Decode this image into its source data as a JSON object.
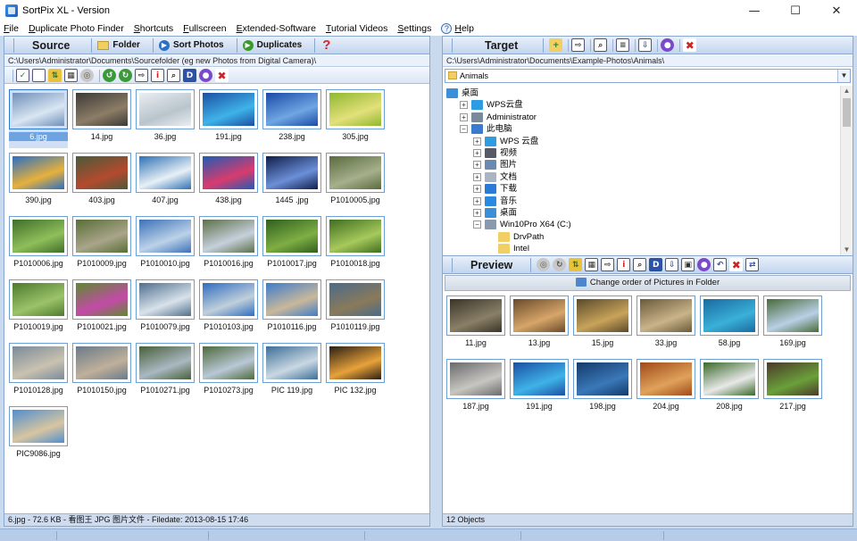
{
  "window": {
    "title": "SortPix XL - Version"
  },
  "menu": [
    {
      "label": "File",
      "ul": "F",
      "rest": "ile"
    },
    {
      "label": "Duplicate Photo Finder",
      "ul": "D",
      "rest": "uplicate Photo Finder"
    },
    {
      "label": "Shortcuts",
      "ul": "S",
      "rest": "hortcuts"
    },
    {
      "label": "Fullscreen",
      "ul": "F",
      "rest": "ullscreen"
    },
    {
      "label": "Extended-Software",
      "ul": "E",
      "rest": "xtended-Software"
    },
    {
      "label": "Tutorial Videos",
      "ul": "T",
      "rest": "utorial Videos"
    },
    {
      "label": "Settings",
      "ul": "S",
      "rest": "ettings"
    },
    {
      "label": "Help",
      "ul": "H",
      "rest": "elp"
    }
  ],
  "source": {
    "title": "Source",
    "buttons": {
      "folder": "Folder",
      "sort": "Sort Photos",
      "duplicates": "Duplicates"
    },
    "path": "C:\\Users\\Administrator\\Documents\\Sourcefolder (eg new Photos from Digital Camera)\\",
    "status": "6.jpg - 72.6 KB - 看图王 JPG 图片文件 - Filedate: 2013-08-15 17:46",
    "thumbs": [
      {
        "name": "6.jpg",
        "c1": "#6f8fb8",
        "c2": "#d9e6f3",
        "selected": true
      },
      {
        "name": "14.jpg",
        "c1": "#3c3a36",
        "c2": "#8c7d66"
      },
      {
        "name": "36.jpg",
        "c1": "#e9eef2",
        "c2": "#b9c4cc"
      },
      {
        "name": "191.jpg",
        "c1": "#1b4fa3",
        "c2": "#3fb3e8"
      },
      {
        "name": "238.jpg",
        "c1": "#1a4aa8",
        "c2": "#6fa6e2"
      },
      {
        "name": "305.jpg",
        "c1": "#8fb830",
        "c2": "#e3e07a"
      },
      {
        "name": "390.jpg",
        "c1": "#2a6ec4",
        "c2": "#e7b13b"
      },
      {
        "name": "403.jpg",
        "c1": "#4a5a3a",
        "c2": "#b44a2e"
      },
      {
        "name": "407.jpg",
        "c1": "#2f71b5",
        "c2": "#e8f0f6"
      },
      {
        "name": "438.jpg",
        "c1": "#1f5cb4",
        "c2": "#d93b6e"
      },
      {
        "name": "1445 .jpg",
        "c1": "#0f1e4a",
        "c2": "#6c8fd8"
      },
      {
        "name": "P1010005.jpg",
        "c1": "#5a6a3e",
        "c2": "#a6b08c"
      },
      {
        "name": "P1010006.jpg",
        "c1": "#3f6e2a",
        "c2": "#8fbf5a"
      },
      {
        "name": "P1010009.jpg",
        "c1": "#596d36",
        "c2": "#a9a58a"
      },
      {
        "name": "P1010010.jpg",
        "c1": "#3b71b8",
        "c2": "#bcd2e8"
      },
      {
        "name": "P1010016.jpg",
        "c1": "#5c7048",
        "c2": "#c6d0dc"
      },
      {
        "name": "P1010017.jpg",
        "c1": "#2f5f1e",
        "c2": "#7fae44"
      },
      {
        "name": "P1010018.jpg",
        "c1": "#3e6e20",
        "c2": "#a7c95c"
      },
      {
        "name": "P1010019.jpg",
        "c1": "#4d7a2d",
        "c2": "#9bc36a"
      },
      {
        "name": "P1010021.jpg",
        "c1": "#5d8a2f",
        "c2": "#c44aa8"
      },
      {
        "name": "P1010079.jpg",
        "c1": "#4f6f8f",
        "c2": "#d8e2ea"
      },
      {
        "name": "P1010103.jpg",
        "c1": "#2f6cc0",
        "c2": "#c0cfda"
      },
      {
        "name": "P1010116.jpg",
        "c1": "#3e7ccb",
        "c2": "#c9b89a"
      },
      {
        "name": "P1010119.jpg",
        "c1": "#4a6a8a",
        "c2": "#8a7a5a"
      },
      {
        "name": "P1010128.jpg",
        "c1": "#7a8a9a",
        "c2": "#c9c2b0"
      },
      {
        "name": "P1010150.jpg",
        "c1": "#6a7a8a",
        "c2": "#bfb09a"
      },
      {
        "name": "P1010271.jpg",
        "c1": "#48603a",
        "c2": "#aab8c2"
      },
      {
        "name": "P1010273.jpg",
        "c1": "#4e6a3c",
        "c2": "#b9c8d6"
      },
      {
        "name": "PIC 119.jpg",
        "c1": "#3d6e98",
        "c2": "#c9d8e2"
      },
      {
        "name": "PIC 132.jpg",
        "c1": "#2a1e14",
        "c2": "#e8a23a"
      },
      {
        "name": "PIC9086.jpg",
        "c1": "#4f8fcf",
        "c2": "#d8c5a0"
      }
    ]
  },
  "target": {
    "title": "Target",
    "path": "C:\\Users\\Administrator\\Documents\\Example-Photos\\Animals\\",
    "combo": "Animals",
    "tree": [
      {
        "label": "桌面",
        "depth": 0,
        "exp": "",
        "icon": "#3a8fd8"
      },
      {
        "label": "WPS云盘",
        "depth": 1,
        "exp": "+",
        "icon": "#2f9be0"
      },
      {
        "label": "Administrator",
        "depth": 1,
        "exp": "+",
        "icon": "#7a8a9a"
      },
      {
        "label": "此电脑",
        "depth": 1,
        "exp": "−",
        "icon": "#3a7bd0"
      },
      {
        "label": "WPS 云盘",
        "depth": 2,
        "exp": "+",
        "icon": "#2f9be0"
      },
      {
        "label": "视频",
        "depth": 2,
        "exp": "+",
        "icon": "#555a66"
      },
      {
        "label": "图片",
        "depth": 2,
        "exp": "+",
        "icon": "#6a8ab0"
      },
      {
        "label": "文档",
        "depth": 2,
        "exp": "+",
        "icon": "#aab4c4"
      },
      {
        "label": "下载",
        "depth": 2,
        "exp": "+",
        "icon": "#2a7ad8"
      },
      {
        "label": "音乐",
        "depth": 2,
        "exp": "+",
        "icon": "#2a8ae0"
      },
      {
        "label": "桌面",
        "depth": 2,
        "exp": "+",
        "icon": "#3a8fd8"
      },
      {
        "label": "Win10Pro X64 (C:)",
        "depth": 2,
        "exp": "−",
        "icon": "#8a9aae"
      },
      {
        "label": "DrvPath",
        "depth": 3,
        "exp": "",
        "icon": "#f2cf62"
      },
      {
        "label": "Intel",
        "depth": 3,
        "exp": "",
        "icon": "#f2cf62"
      }
    ]
  },
  "preview": {
    "title": "Preview",
    "change_order": "Change order of Pictures in Folder",
    "status": "12 Objects",
    "thumbs": [
      {
        "name": "11.jpg",
        "c1": "#3a3428",
        "c2": "#8a8068"
      },
      {
        "name": "13.jpg",
        "c1": "#6a4a2a",
        "c2": "#d6a66a"
      },
      {
        "name": "15.jpg",
        "c1": "#5a4a2a",
        "c2": "#c8a35a"
      },
      {
        "name": "33.jpg",
        "c1": "#6a5a3a",
        "c2": "#c9b48a"
      },
      {
        "name": "58.jpg",
        "c1": "#1a6aa0",
        "c2": "#3ab0d8"
      },
      {
        "name": "169.jpg",
        "c1": "#4a6a3a",
        "c2": "#b8d0e6"
      },
      {
        "name": "187.jpg",
        "c1": "#6a6a6e",
        "c2": "#c8c6c0"
      },
      {
        "name": "191.jpg",
        "c1": "#1b4fa3",
        "c2": "#3fb3e8"
      },
      {
        "name": "198.jpg",
        "c1": "#143a6a",
        "c2": "#3a78b8"
      },
      {
        "name": "204.jpg",
        "c1": "#a04a1a",
        "c2": "#e0a25a"
      },
      {
        "name": "208.jpg",
        "c1": "#3a6a2a",
        "c2": "#e8e8e8"
      },
      {
        "name": "217.jpg",
        "c1": "#4a3a2a",
        "c2": "#6aa03a"
      }
    ]
  }
}
